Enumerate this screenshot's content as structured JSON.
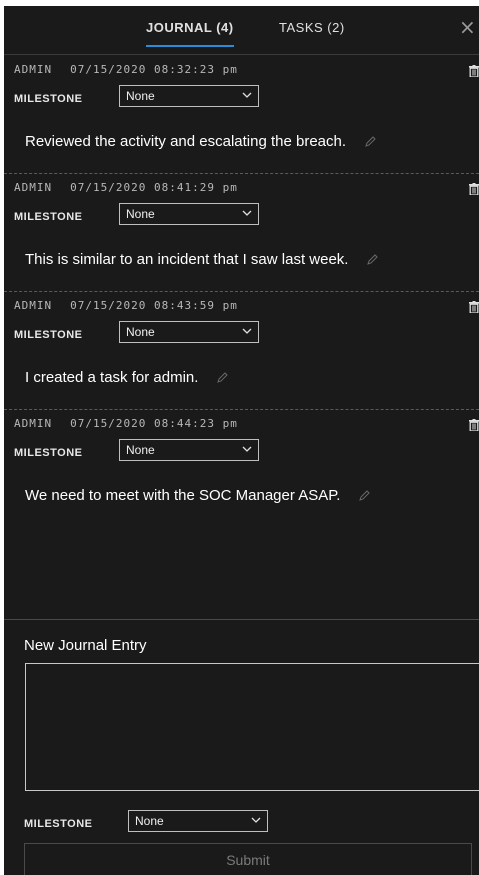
{
  "tabs": [
    {
      "label": "JOURNAL (4)",
      "active": true
    },
    {
      "label": "TASKS (2)",
      "active": false
    }
  ],
  "close_icon": "close-icon",
  "entries": [
    {
      "author": "ADMIN",
      "timestamp": "07/15/2020 08:32:23 pm",
      "milestone_label": "MILESTONE",
      "milestone_value": "None",
      "text": "Reviewed the activity and escalating the breach."
    },
    {
      "author": "ADMIN",
      "timestamp": "07/15/2020 08:41:29 pm",
      "milestone_label": "MILESTONE",
      "milestone_value": "None",
      "text": "This is similar to an incident that I saw last week."
    },
    {
      "author": "ADMIN",
      "timestamp": "07/15/2020 08:43:59 pm",
      "milestone_label": "MILESTONE",
      "milestone_value": "None",
      "text": "I created a task for admin."
    },
    {
      "author": "ADMIN",
      "timestamp": "07/15/2020 08:44:23 pm",
      "milestone_label": "MILESTONE",
      "milestone_value": "None",
      "text": "We need to meet with the SOC Manager ASAP."
    }
  ],
  "new_entry": {
    "title": "New Journal Entry",
    "text_value": "",
    "milestone_label": "MILESTONE",
    "milestone_value": "None",
    "submit_label": "Submit"
  },
  "colors": {
    "panel_bg": "#1a1a1a",
    "accent": "#2d8cd8",
    "text": "#ffffff",
    "muted": "#b8b8b8"
  }
}
